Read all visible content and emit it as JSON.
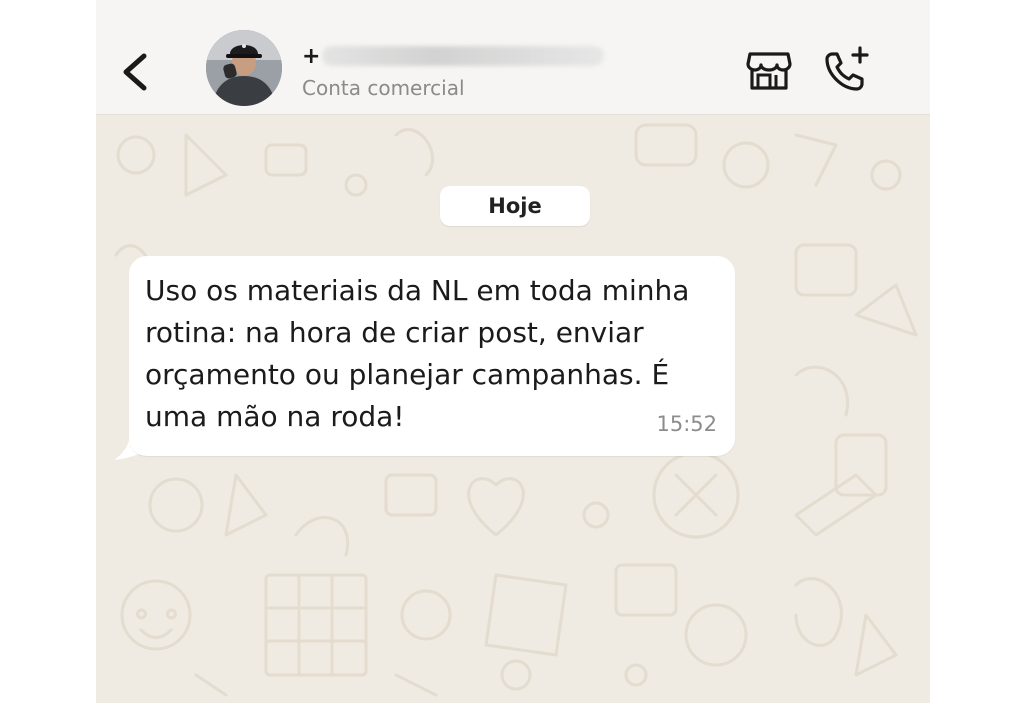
{
  "header": {
    "back_icon": "chevron-left-icon",
    "avatar_icon": "profile-photo",
    "contact_name": "+",
    "contact_subtitle": "Conta comercial",
    "store_icon": "storefront-icon",
    "call_icon": "add-call-icon"
  },
  "chat": {
    "date_label": "Hoje",
    "messages": [
      {
        "text": "Uso os materiais da NL em toda minha\nrotina: na hora de criar post, enviar\norçamento ou planejar campanhas. É\numa mão na roda!",
        "time": "15:52",
        "direction": "incoming"
      }
    ]
  },
  "colors": {
    "chat_background": "#efeae2",
    "header_background": "#f6f5f3",
    "bubble_background": "#ffffff"
  }
}
